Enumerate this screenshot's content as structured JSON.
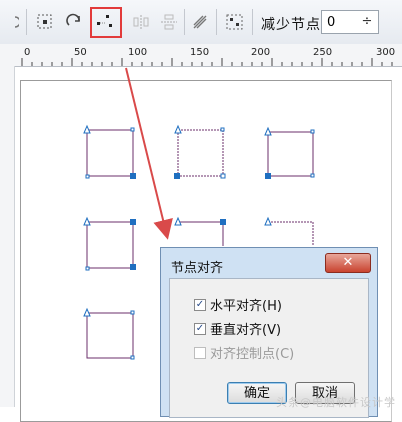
{
  "toolbar": {
    "reduce_nodes_label": "减少节点",
    "reduce_nodes_value": "0",
    "spin_symbol": "÷"
  },
  "ruler": {
    "ticks": [
      "0",
      "50",
      "100",
      "150",
      "200",
      "250",
      "300"
    ]
  },
  "dialog": {
    "title": "节点对齐",
    "close_symbol": "✕",
    "options": [
      {
        "label": "水平对齐(H)",
        "checked": true,
        "enabled": true
      },
      {
        "label": "垂直对齐(V)",
        "checked": true,
        "enabled": true
      },
      {
        "label": "对齐控制点(C)",
        "checked": false,
        "enabled": false
      }
    ],
    "ok_label": "确定",
    "cancel_label": "取消"
  },
  "watermark": "头条@电脑软件设计学",
  "colors": {
    "highlight": "#e23a3a",
    "arrow": "#d94a4a",
    "node": "#1f6fc0",
    "shape_line": "#6b2f6b"
  }
}
